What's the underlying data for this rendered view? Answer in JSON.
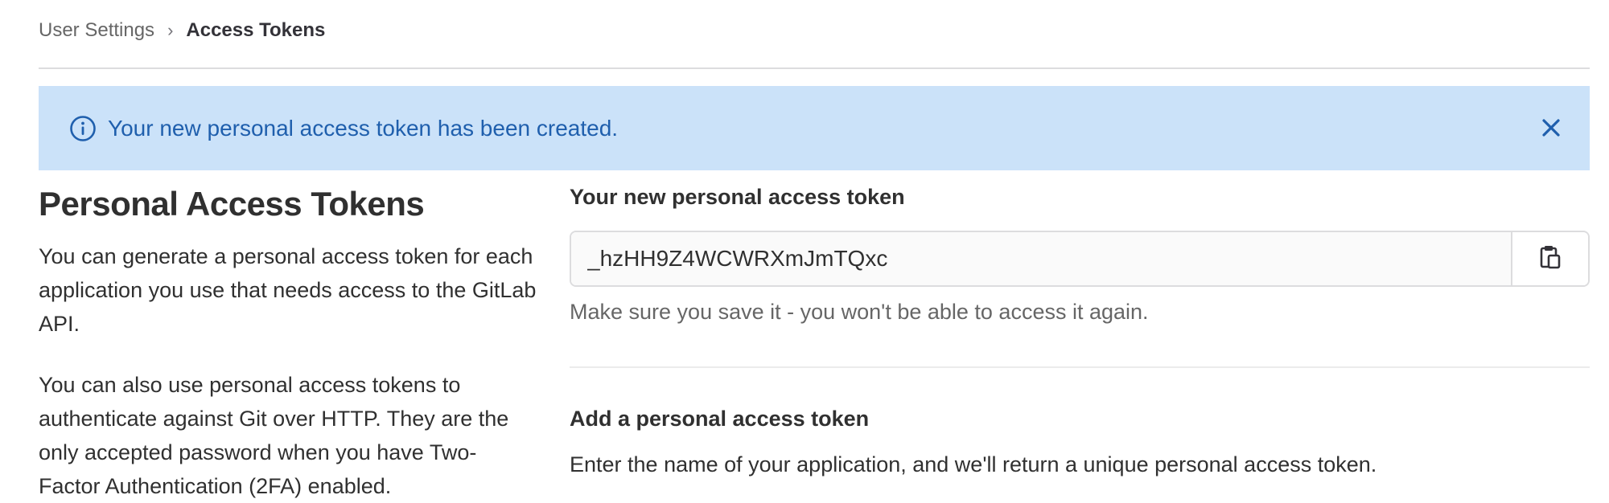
{
  "breadcrumb": {
    "parent": "User Settings",
    "separator": "›",
    "current": "Access Tokens"
  },
  "alert": {
    "message": "Your new personal access token has been created.",
    "icon": "info-circle-icon",
    "close_icon": "close-icon",
    "color": "#1f5fad",
    "background": "#cbe2f9"
  },
  "page": {
    "title": "Personal Access Tokens",
    "description_1": "You can generate a personal access token for each application you use that needs access to the GitLab API.",
    "description_2": "You can also use personal access tokens to authenticate against Git over HTTP. They are the only accepted password when you have Two-Factor Authentication (2FA) enabled."
  },
  "new_token": {
    "label": "Your new personal access token",
    "value": "_hzHH9Z4WCWRXmJmTQxc",
    "copy_icon": "clipboard-icon",
    "help": "Make sure you save it - you won't be able to access it again."
  },
  "add_token": {
    "title": "Add a personal access token",
    "description": "Enter the name of your application, and we'll return a unique personal access token."
  }
}
